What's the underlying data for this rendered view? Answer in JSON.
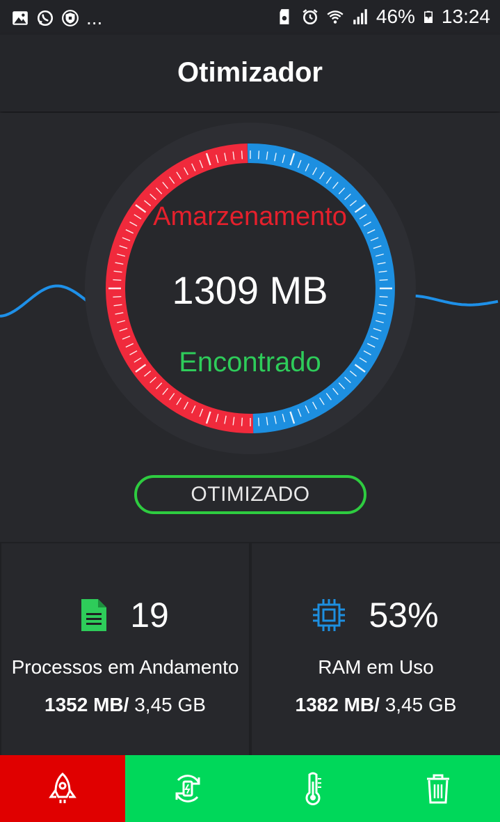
{
  "status_bar": {
    "left_icons": [
      "gallery-icon",
      "whatsapp-icon",
      "vpn-shield-icon"
    ],
    "overflow": "...",
    "battery_percent": "46%",
    "time": "13:24",
    "right_icons": [
      "sd-card-icon",
      "alarm-icon",
      "wifi-icon",
      "signal-icon",
      "battery-charging-icon"
    ]
  },
  "app_bar": {
    "title": "Otimizador"
  },
  "gauge": {
    "storage_label": "Amarzenamento",
    "size_value": "1309 MB",
    "found_label": "Encontrado",
    "red_fraction": 0.5,
    "colors": {
      "red": "#f02a3c",
      "blue": "#1d8fe0",
      "wave": "#1e90e8"
    }
  },
  "optimize_button": {
    "label": "OTIMIZADO"
  },
  "stats": {
    "processes": {
      "icon": "document-icon",
      "value": "19",
      "title": "Processos em Andamento",
      "used": "1352 MB/",
      "total": "3,45 GB"
    },
    "ram": {
      "icon": "cpu-chip-icon",
      "value": "53%",
      "title": "RAM em Uso",
      "used": "1382 MB/",
      "total": "3,45 GB"
    }
  },
  "nav": {
    "items": [
      {
        "icon": "rocket-icon",
        "active": true
      },
      {
        "icon": "battery-cycle-icon",
        "active": false
      },
      {
        "icon": "thermometer-icon",
        "active": false
      },
      {
        "icon": "trash-icon",
        "active": false
      }
    ],
    "colors": {
      "active": "#e00000",
      "inactive": "#00d85a"
    }
  }
}
